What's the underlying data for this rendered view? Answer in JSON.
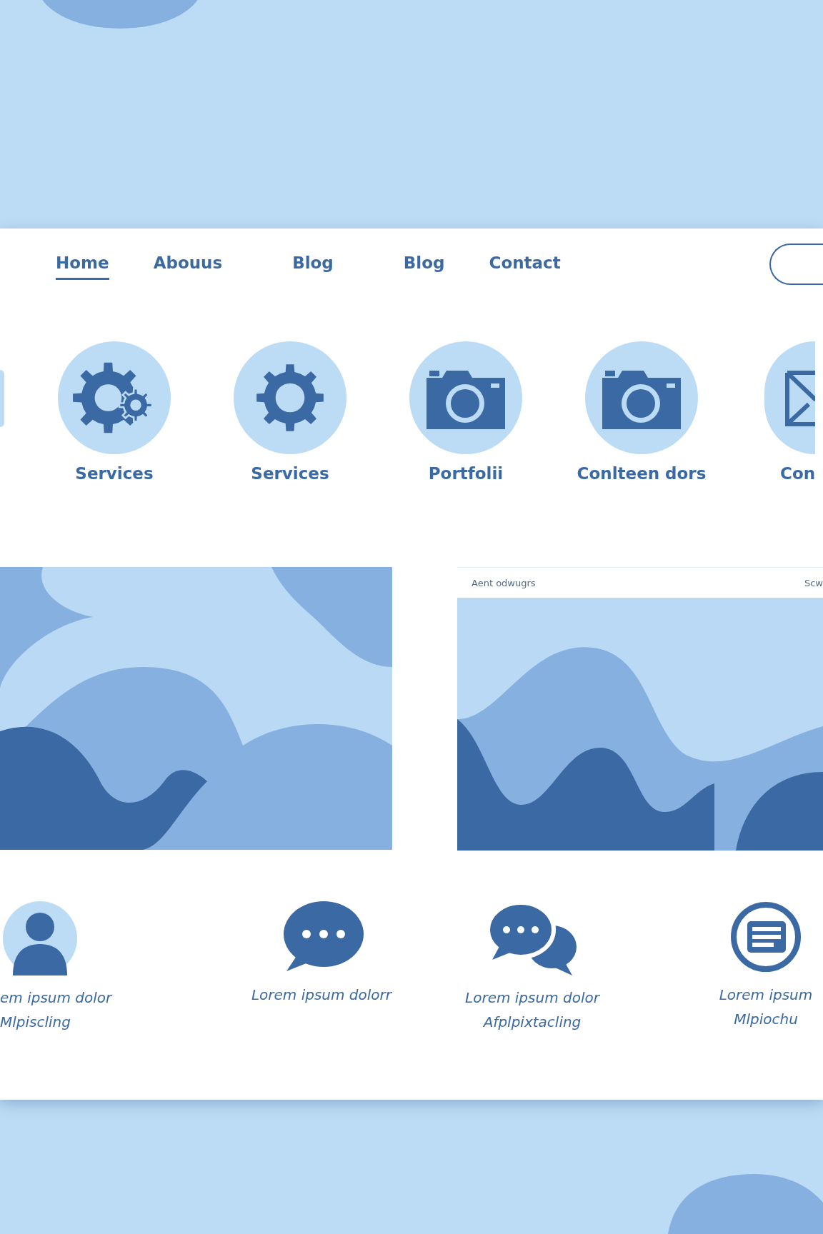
{
  "nav": {
    "items": [
      {
        "label": "Home",
        "selected": true
      },
      {
        "label": "Abouus",
        "selected": false
      },
      {
        "label": "Blog",
        "selected": false
      },
      {
        "label": "Blog",
        "selected": false
      },
      {
        "label": "Contact",
        "selected": false
      }
    ]
  },
  "features": [
    {
      "kind": "gears",
      "label": "Services"
    },
    {
      "kind": "gear",
      "label": "Services"
    },
    {
      "kind": "camera",
      "label": "Portfolii"
    },
    {
      "kind": "camera",
      "label": "Conlteen dors"
    },
    {
      "kind": "envelope",
      "label": "Con"
    }
  ],
  "media": [
    {
      "kind": "picture"
    },
    {
      "kind": "card",
      "header": "Aent odwugrs",
      "action": "Scw"
    }
  ],
  "highlights": [
    {
      "kind": "person",
      "lines": [
        "em ipsum dolor",
        "Mlpiscling"
      ]
    },
    {
      "kind": "chat",
      "lines": [
        "Lorem ipsum dolorr"
      ]
    },
    {
      "kind": "chats",
      "lines": [
        "Lorem ipsum dolor",
        "Afplpixtacling"
      ]
    },
    {
      "kind": "document",
      "lines": [
        "Lorem ipsum",
        "Mlpiochu"
      ]
    }
  ]
}
